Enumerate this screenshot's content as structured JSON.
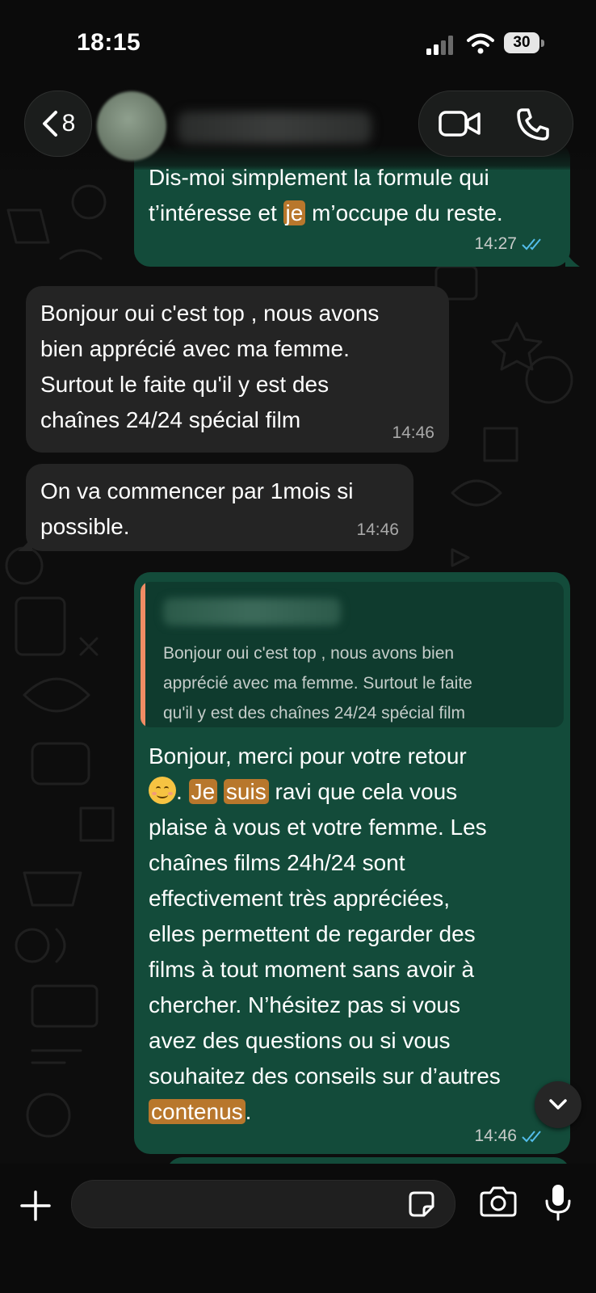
{
  "status_bar": {
    "time": "18:15",
    "battery": "30"
  },
  "header": {
    "back_count": "8"
  },
  "messages": {
    "m1": {
      "partial_line": "Dis-moi simplement la formule qui",
      "line2_before": "t’intéresse et ",
      "line2_hl": "je",
      "line2_after": " m’occupe du reste.",
      "time": "14:27"
    },
    "m2": {
      "lines": [
        "Bonjour oui c'est top , nous avons",
        "bien apprécié avec ma femme.",
        "Surtout le faite qu'il y est des",
        "chaînes 24/24 spécial film"
      ],
      "time": "14:46"
    },
    "m3": {
      "lines": [
        "On va commencer par 1mois si",
        "possible."
      ],
      "time": "14:46"
    },
    "m4": {
      "quote_lines": [
        "Bonjour oui c'est top , nous avons bien",
        "apprécié avec ma femme. Surtout le faite",
        "qu'il y est des chaînes 24/24 spécial film"
      ],
      "l1": "Bonjour, merci pour votre retour",
      "l2_sep": ". ",
      "l2_hl1": "Je",
      "l2_hl2": "suis",
      "l2_after": " ravi que cela vous",
      "l3": "plaise à vous et votre femme. Les",
      "l4": "chaînes films 24h/24 sont",
      "l5": "effectivement très appréciées,",
      "l6": "elles permettent de regarder des",
      "l7": "films à tout moment sans avoir à",
      "l8": "chercher. N’hésitez pas si vous",
      "l9": "avez des questions ou si vous",
      "l10": "souhaitez des conseils sur d’autres",
      "l11_hl": "contenus",
      "l11_after": ".",
      "time": "14:46"
    }
  },
  "input": {
    "placeholder": "",
    "value": ""
  },
  "colors": {
    "outgoing_bubble": "#134b3a",
    "incoming_bubble": "#242424",
    "highlight": "#b8772c",
    "read_ticks": "#53bdeb",
    "quote_bar": "#f08c64"
  },
  "icons": [
    "back-chevron-icon",
    "video-call-icon",
    "phone-call-icon",
    "read-receipt-icon",
    "chevron-down-icon",
    "plus-icon",
    "sticker-icon",
    "camera-icon",
    "microphone-icon"
  ]
}
